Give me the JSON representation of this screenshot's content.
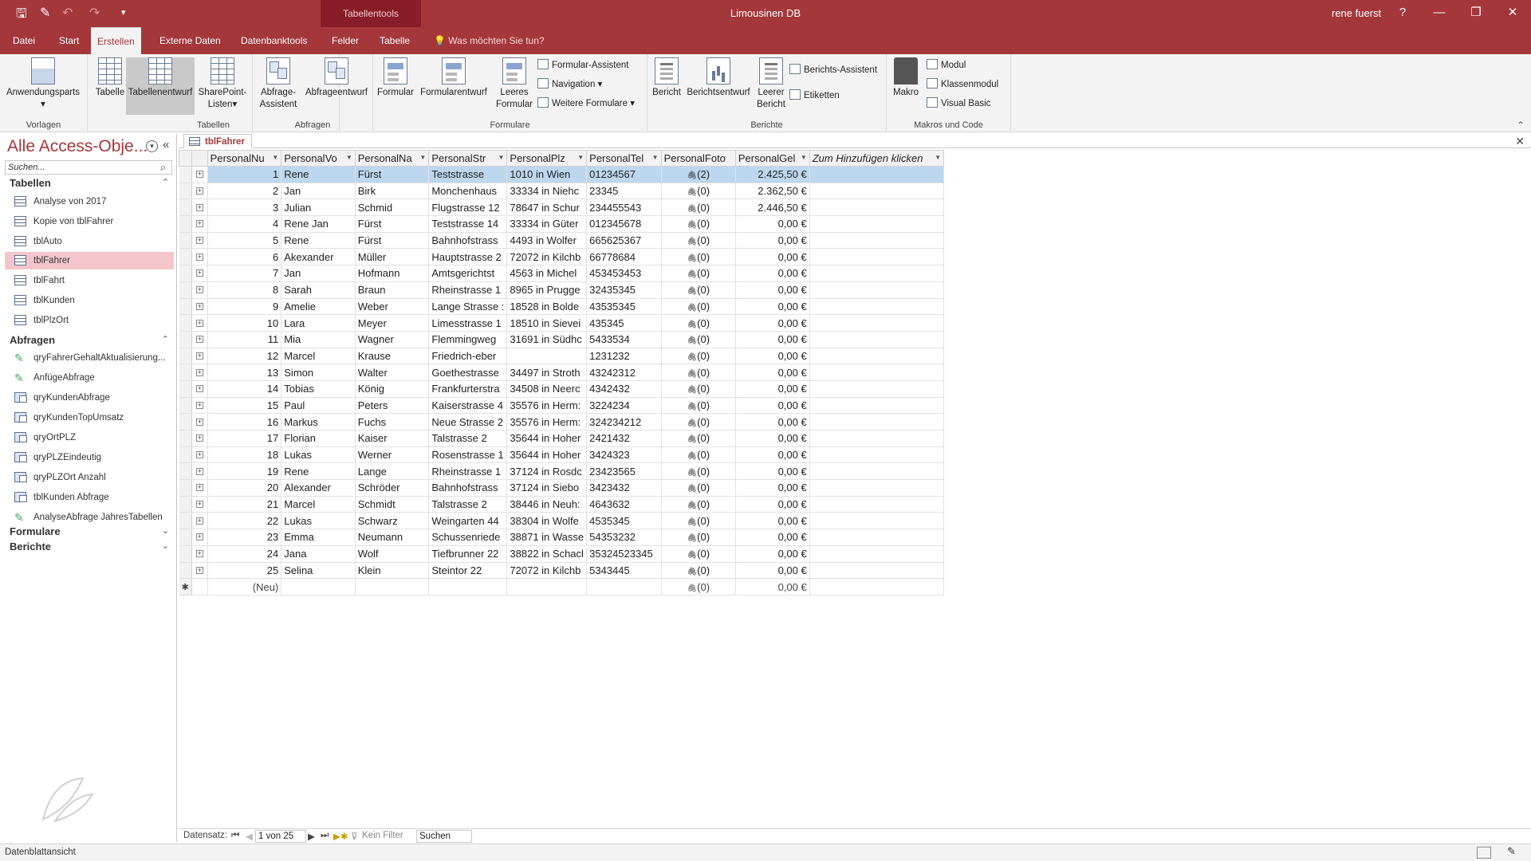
{
  "titlebar": {
    "context_tab": "Tabellentools",
    "app_title": "Limousinen DB",
    "user": "rene fuerst",
    "help": "?"
  },
  "menu": {
    "tabs": [
      "Datei",
      "Start",
      "Erstellen",
      "Externe Daten",
      "Datenbanktools",
      "Felder",
      "Tabelle"
    ],
    "search": "Was möchten Sie tun?"
  },
  "ribbon": {
    "groups": {
      "vorlagen": {
        "label": "Vorlagen",
        "anwendungsparts": "Anwendungsparts"
      },
      "tabellen": {
        "label": "Tabellen",
        "tabelle": "Tabelle",
        "tabellenentwurf": "Tabellenentwurf",
        "sharepoint": "SharePoint-",
        "sharepoint2": "Listen"
      },
      "abfragen": {
        "label": "Abfragen",
        "assistent": "Abfrage-",
        "assistent2": "Assistent",
        "entwurf": "Abfrageentwurf"
      },
      "formulare": {
        "label": "Formulare",
        "formular": "Formular",
        "entwurf": "Formularentwurf",
        "leeres": "Leeres",
        "leeres2": "Formular",
        "assistent": "Formular-Assistent",
        "navigation": "Navigation",
        "weitere": "Weitere Formulare"
      },
      "berichte": {
        "label": "Berichte",
        "bericht": "Bericht",
        "entwurf": "Berichtsentwurf",
        "leerer": "Leerer",
        "leerer2": "Bericht",
        "assistent": "Berichts-Assistent",
        "etiketten": "Etiketten"
      },
      "makros": {
        "label": "Makros und Code",
        "makro": "Makro",
        "modul": "Modul",
        "klassenmodul": "Klassenmodul",
        "vba": "Visual Basic"
      }
    }
  },
  "nav": {
    "title": "Alle Access-Obje...",
    "search_placeholder": "Suchen...",
    "sections": {
      "tabellen": "Tabellen",
      "abfragen": "Abfragen",
      "formulare": "Formulare",
      "berichte": "Berichte"
    },
    "tables": [
      "Analyse von 2017",
      "Kopie von tblFahrer",
      "tblAuto",
      "tblFahrer",
      "tblFahrt",
      "tblKunden",
      "tblPlzOrt"
    ],
    "queries": [
      "qryFahrerGehaltAktualisierung...",
      "AnfügeAbfrage",
      "qryKundenAbfrage",
      "qryKundenTopUmsatz",
      "qryOrtPLZ",
      "qryPLZEindeutig",
      "qryPLZOrt Anzahl",
      "tblKunden Abfrage",
      "AnalyseAbfrage JahresTabellen"
    ]
  },
  "doc": {
    "tab": "tblFahrer"
  },
  "grid": {
    "columns": [
      "PersonalNu",
      "PersonalVo",
      "PersonalNa",
      "PersonalStr",
      "PersonalPlz",
      "PersonalTel",
      "PersonalFoto",
      "PersonalGel",
      "Zum Hinzufügen klicken"
    ],
    "rows": [
      [
        "1",
        "Rene",
        "Fürst",
        "Teststrasse",
        "1010 in Wien",
        "01234567",
        "(2)",
        "2.425,50 €"
      ],
      [
        "2",
        "Jan",
        "Birk",
        "Monchenhaus",
        "33334 in Niehc",
        "23345",
        "(0)",
        "2.362,50 €"
      ],
      [
        "3",
        "Julian",
        "Schmid",
        "Flugstrasse 12",
        "78647 in Schur",
        "234455543",
        "(0)",
        "2.446,50 €"
      ],
      [
        "4",
        "Rene Jan",
        "Fürst",
        "Teststrasse 14",
        "33334 in Güter",
        "012345678",
        "(0)",
        "0,00 €"
      ],
      [
        "5",
        "Rene",
        "Fürst",
        "Bahnhofstrass",
        "4493 in Wolfer",
        "665625367",
        "(0)",
        "0,00 €"
      ],
      [
        "6",
        "Akexander",
        "Müller",
        "Hauptstrasse 2",
        "72072 in Kilchb",
        "66778684",
        "(0)",
        "0,00 €"
      ],
      [
        "7",
        "Jan",
        "Hofmann",
        "Amtsgerichtst",
        "4563 in Michel",
        "453453453",
        "(0)",
        "0,00 €"
      ],
      [
        "8",
        "Sarah",
        "Braun",
        "Rheinstrasse 1",
        "8965 in Prugge",
        "32435345",
        "(0)",
        "0,00 €"
      ],
      [
        "9",
        "Amelie",
        "Weber",
        "Lange Strasse :",
        "18528 in Bolde",
        "43535345",
        "(0)",
        "0,00 €"
      ],
      [
        "10",
        "Lara",
        "Meyer",
        "Limesstrasse 1",
        "18510 in Sievei",
        "435345",
        "(0)",
        "0,00 €"
      ],
      [
        "11",
        "Mia",
        "Wagner",
        "Flemmingweg",
        "31691 in Südhc",
        "5433534",
        "(0)",
        "0,00 €"
      ],
      [
        "12",
        "Marcel",
        "Krause",
        "Friedrich-eber",
        "",
        "1231232",
        "(0)",
        "0,00 €"
      ],
      [
        "13",
        "Simon",
        "Walter",
        "Goethestrasse",
        "34497 in Stroth",
        "43242312",
        "(0)",
        "0,00 €"
      ],
      [
        "14",
        "Tobias",
        "König",
        "Frankfurterstra",
        "34508 in Neerc",
        "4342432",
        "(0)",
        "0,00 €"
      ],
      [
        "15",
        "Paul",
        "Peters",
        "Kaiserstrasse 4",
        "35576 in Herm:",
        "3224234",
        "(0)",
        "0,00 €"
      ],
      [
        "16",
        "Markus",
        "Fuchs",
        "Neue Strasse 2",
        "35576 in Herm:",
        "324234212",
        "(0)",
        "0,00 €"
      ],
      [
        "17",
        "Florian",
        "Kaiser",
        "Talstrasse 2",
        "35644 in Hoher",
        "2421432",
        "(0)",
        "0,00 €"
      ],
      [
        "18",
        "Lukas",
        "Werner",
        "Rosenstrasse 1",
        "35644 in Hoher",
        "3424323",
        "(0)",
        "0,00 €"
      ],
      [
        "19",
        "Rene",
        "Lange",
        "Rheinstrasse 1",
        "37124 in Rosdc",
        "23423565",
        "(0)",
        "0,00 €"
      ],
      [
        "20",
        "Alexander",
        "Schröder",
        "Bahnhofstrass",
        "37124 in Siebo",
        "3423432",
        "(0)",
        "0,00 €"
      ],
      [
        "21",
        "Marcel",
        "Schmidt",
        "Talstrasse 2",
        "38446 in Neuh:",
        "4643632",
        "(0)",
        "0,00 €"
      ],
      [
        "22",
        "Lukas",
        "Schwarz",
        "Weingarten 44",
        "38304 in Wolfe",
        "4535345",
        "(0)",
        "0,00 €"
      ],
      [
        "23",
        "Emma",
        "Neumann",
        "Schussenriede",
        "38871 in Wasse",
        "54353232",
        "(0)",
        "0,00 €"
      ],
      [
        "24",
        "Jana",
        "Wolf",
        "Tiefbrunner 22",
        "38822 in Schacl",
        "35324523345",
        "(0)",
        "0,00 €"
      ],
      [
        "25",
        "Selina",
        "Klein",
        "Steintor 22",
        "72072 in Kilchb",
        "5343445",
        "(0)",
        "0,00 €"
      ]
    ],
    "new_row": {
      "label": "(Neu)",
      "attachments": "(0)",
      "salary": "0,00 €"
    }
  },
  "recnav": {
    "label": "Datensatz:",
    "position": "1 von 25",
    "filter": "Kein Filter",
    "search": "Suchen"
  },
  "status": {
    "view": "Datenblattansicht"
  },
  "colors": {
    "accent": "#a4373a",
    "selection": "#bdd7ee",
    "nav_selection": "#f4c6cb"
  }
}
